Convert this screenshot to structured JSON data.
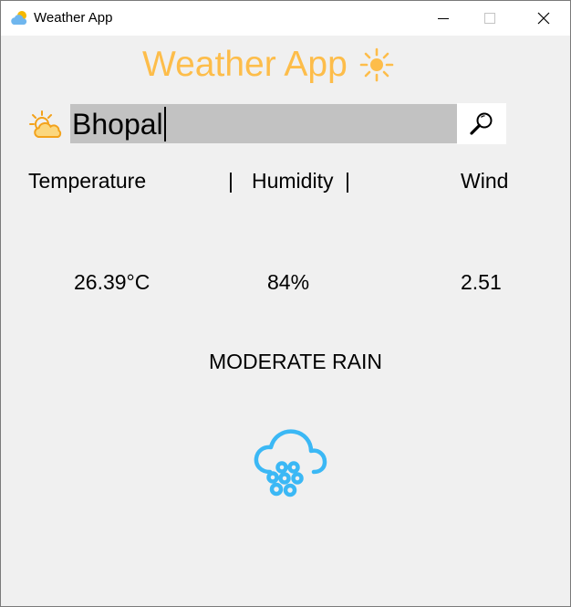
{
  "window": {
    "title": "Weather App"
  },
  "app": {
    "heading": "Weather App",
    "heading_icon": "sun-icon",
    "heading_color": "#fdbd4a"
  },
  "search": {
    "city_value": "Bhopal",
    "city_icon": "sun-cloud-icon",
    "button_icon": "magnifier-icon"
  },
  "labels": {
    "temperature": "Temperature",
    "separator_1": "|",
    "humidity": "Humidity",
    "separator_2": "|",
    "wind": "Wind"
  },
  "values": {
    "temperature": "26.39°C",
    "humidity": "84%",
    "wind": "2.51"
  },
  "condition": {
    "text": "MODERATE RAIN",
    "icon": "rain-cloud-icon",
    "icon_color": "#3bb8f5"
  }
}
